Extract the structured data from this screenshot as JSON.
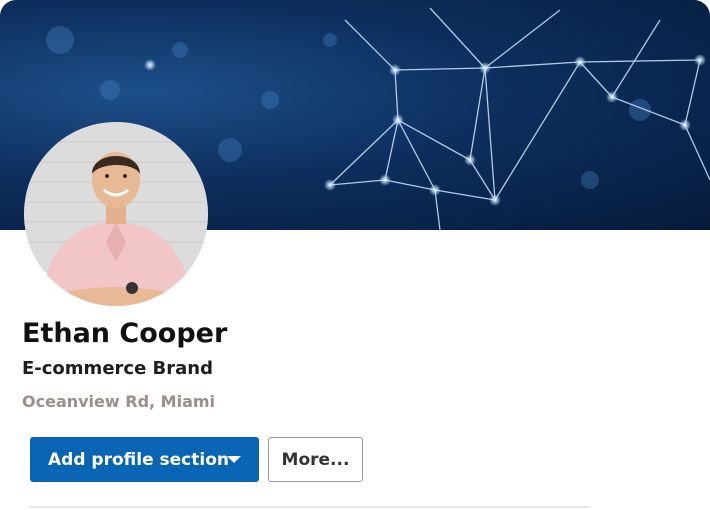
{
  "profile": {
    "name": "Ethan Cooper",
    "headline": "E-commerce Brand",
    "location": "Oceanview Rd, Miami"
  },
  "actions": {
    "add_profile_section_label": "Add profile section",
    "more_label": "More..."
  },
  "icons": {
    "dropdown": "chevron-down-icon"
  },
  "colors": {
    "primary_button": "#0a66b5",
    "banner": "#0d2f5e",
    "location_text": "#9a8f8a"
  }
}
